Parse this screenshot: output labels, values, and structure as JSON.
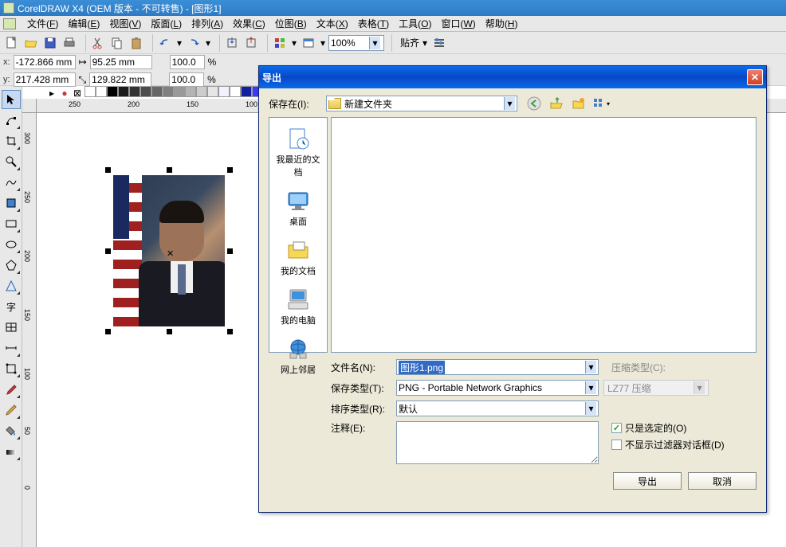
{
  "titlebar": {
    "title": "CorelDRAW X4 (OEM 版本 - 不可转售) - [图形1]"
  },
  "menu": {
    "items": [
      {
        "label": "文件",
        "key": "F"
      },
      {
        "label": "编辑",
        "key": "E"
      },
      {
        "label": "视图",
        "key": "V"
      },
      {
        "label": "版面",
        "key": "L"
      },
      {
        "label": "排列",
        "key": "A"
      },
      {
        "label": "效果",
        "key": "C"
      },
      {
        "label": "位图",
        "key": "B"
      },
      {
        "label": "文本",
        "key": "X"
      },
      {
        "label": "表格",
        "key": "T"
      },
      {
        "label": "工具",
        "key": "O"
      },
      {
        "label": "窗口",
        "key": "W"
      },
      {
        "label": "帮助",
        "key": "H"
      }
    ]
  },
  "toolbar": {
    "zoom": "100%",
    "snap_label": "贴齐"
  },
  "properties": {
    "x_label": "x:",
    "x": "-172.866 mm",
    "y_label": "y:",
    "y": "217.428 mm",
    "w": "95.25 mm",
    "h": "129.822 mm",
    "sx": "100.0",
    "sy": "100.0",
    "pct": "%"
  },
  "ruler": {
    "h_ticks": [
      "250",
      "200",
      "150",
      "100"
    ],
    "v_ticks": [
      "300",
      "250",
      "200",
      "150",
      "100",
      "50",
      "0"
    ]
  },
  "palette_colors": [
    "#ffffff",
    "#000000",
    "#1a1a1a",
    "#333333",
    "#4d4d4d",
    "#666666",
    "#808080",
    "#999999",
    "#b3b3b3",
    "#cccccc",
    "#e6e6e6",
    "#f2f2ff",
    "#ffffff",
    "#1020a0",
    "#3838ff",
    "#6868f8"
  ],
  "dialog": {
    "title": "导出",
    "save_in_label": "保存在(I):",
    "folder": "新建文件夹",
    "places": [
      {
        "label": "我最近的文档",
        "icon": "recent"
      },
      {
        "label": "桌面",
        "icon": "desktop"
      },
      {
        "label": "我的文档",
        "icon": "mydocs"
      },
      {
        "label": "我的电脑",
        "icon": "mycomputer"
      },
      {
        "label": "网上邻居",
        "icon": "network"
      }
    ],
    "filename_label": "文件名(N):",
    "filename": "图形1.png",
    "savetype_label": "保存类型(T):",
    "savetype": "PNG - Portable Network Graphics",
    "sorttype_label": "排序类型(R):",
    "sorttype": "默认",
    "notes_label": "注释(E):",
    "compress_label": "压缩类型(C):",
    "compress_value": "LZ77 压缩",
    "check_selected": "只是选定的(O)",
    "check_nofilter": "不显示过滤器对话框(D)",
    "export_btn": "导出",
    "cancel_btn": "取消"
  }
}
